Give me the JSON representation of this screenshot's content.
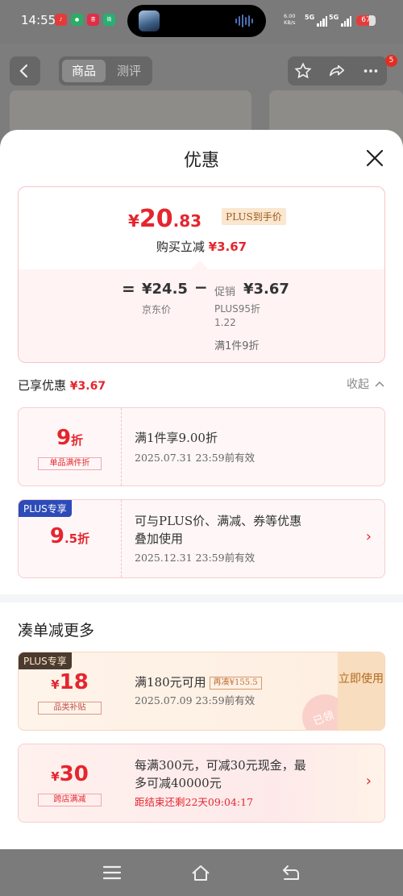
{
  "status_bar": {
    "time": "14:55",
    "app_icons": [
      {
        "name": "netease-music-icon",
        "color": "#e33b3b"
      },
      {
        "name": "wechat-icon",
        "color": "#2aae67"
      },
      {
        "name": "xiaohongshu-icon",
        "color": "#e02e46"
      },
      {
        "name": "weibo-icon",
        "color": "#27b06f"
      }
    ],
    "net_speed_value": "6.00",
    "net_speed_unit": "KB/s",
    "signal_1": "5G",
    "signal_2": "5G",
    "battery": "67",
    "battery_level": 0.67
  },
  "background_page": {
    "tab_product": "商品",
    "tab_review": "测评",
    "cart_badge": "5"
  },
  "sheet": {
    "title": "优惠",
    "price_card": {
      "currency": "¥",
      "price_int": "20",
      "price_dec": ".83",
      "plus_tag": "PLUS到手价",
      "buy_text": "购买立减",
      "buy_amount": "¥3.67",
      "equals": "=",
      "jd_price": "¥24.5",
      "jd_label": "京东价",
      "minus": "−",
      "promo_label": "促销",
      "promo_amount": "¥3.67",
      "promo_sub_1": "PLUS95折",
      "promo_sub_2": "1.22",
      "promo_sub_3": "满1件9折"
    },
    "enjoyed_label": "已享优惠",
    "enjoyed_amount": "¥3.67",
    "collapse_label": "收起",
    "enjoyed_coupons": [
      {
        "value": "9",
        "unit": "折",
        "tag": "单品满件折",
        "desc": "满1件享9.00折",
        "date": "2025.07.31 23:59前有效"
      },
      {
        "ribbon": "PLUS专享",
        "value": "9",
        "unit": ".5折",
        "desc_1": "可与PLUS价、满减、券等优惠",
        "desc_2": "叠加使用",
        "date": "2025.12.31 23:59前有效",
        "arrow": "›"
      }
    ],
    "more_title": "凑单减更多",
    "more_coupons": [
      {
        "ribbon": "PLUS专享",
        "currency": "¥",
        "value": "18",
        "tag": "品类补贴",
        "desc": "满180元可用",
        "ticket_tag": "再凑¥155.5",
        "date": "2025.07.09 23:59前有效",
        "action": "立即使用",
        "stamp": "已领"
      },
      {
        "currency": "¥",
        "value": "30",
        "tag": "跨店满减",
        "desc_1": "每满300元，可减30元现金，最",
        "desc_2": "多可减40000元",
        "countdown": "距结束还剩22天09:04:17",
        "arrow": "›"
      }
    ]
  }
}
